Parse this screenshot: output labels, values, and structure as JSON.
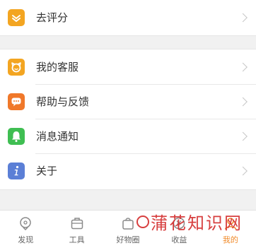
{
  "menu": {
    "rate": {
      "label": "去评分",
      "icon": "thumbs-up-icon",
      "color": "#f3a521"
    },
    "items": [
      {
        "label": "我的客服",
        "icon": "customer-service-icon",
        "color": "#f3a521"
      },
      {
        "label": "帮助与反馈",
        "icon": "chat-bubble-icon",
        "color": "#f0782a"
      },
      {
        "label": "消息通知",
        "icon": "bell-icon",
        "color": "#3fbe52"
      },
      {
        "label": "关于",
        "icon": "info-icon",
        "color": "#5b7fd6"
      }
    ]
  },
  "tabbar": {
    "tabs": [
      {
        "label": "发现",
        "icon": "discover-icon"
      },
      {
        "label": "工具",
        "icon": "toolbox-icon"
      },
      {
        "label": "好物圈",
        "icon": "bag-icon"
      },
      {
        "label": "收益",
        "icon": "earnings-icon"
      },
      {
        "label": "我的",
        "icon": "profile-icon",
        "active": true
      }
    ],
    "active_color": "#f08a2a"
  },
  "watermark": {
    "text": "蒲花知识网"
  }
}
